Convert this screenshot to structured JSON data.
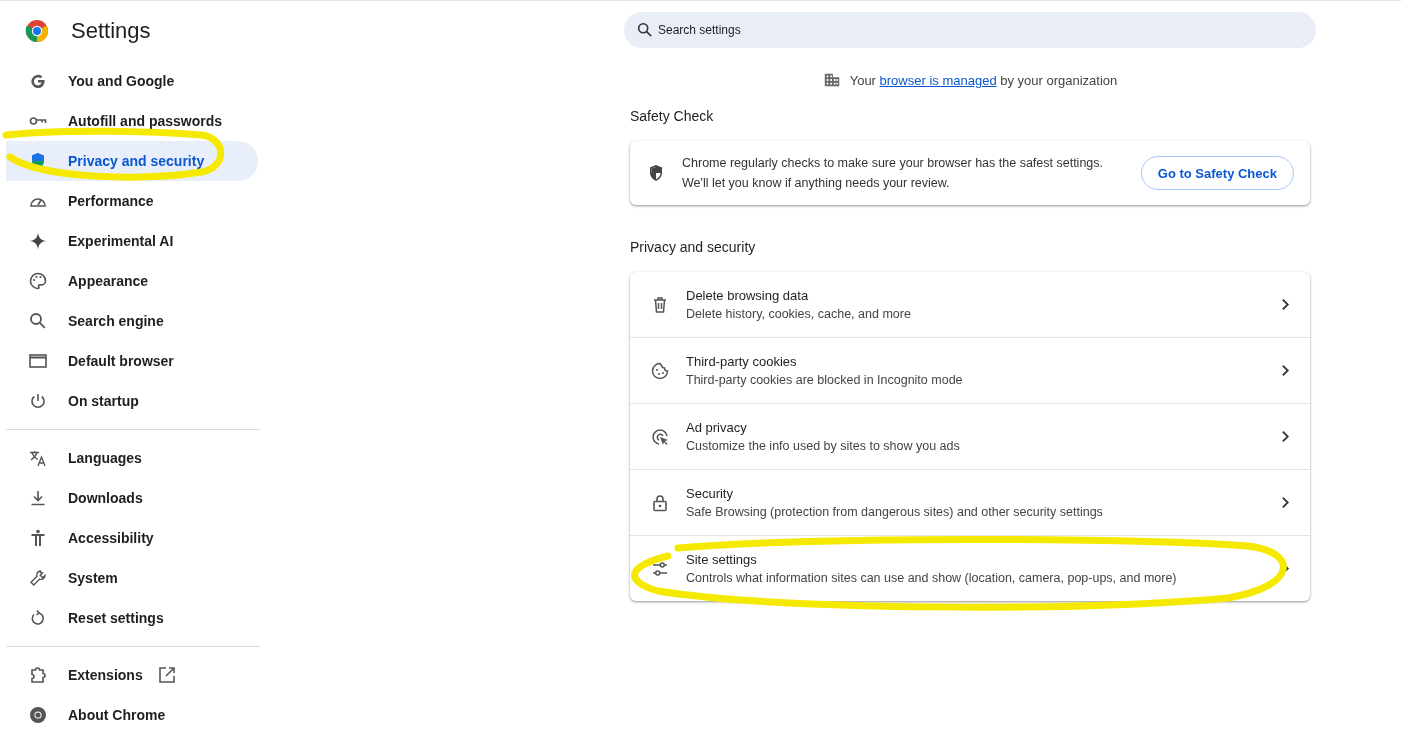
{
  "app": {
    "title": "Settings"
  },
  "sidebar": {
    "groups": [
      {
        "items": [
          {
            "label": "You and Google",
            "selected": false
          },
          {
            "label": "Autofill and passwords",
            "selected": false
          },
          {
            "label": "Privacy and security",
            "selected": true
          },
          {
            "label": "Performance",
            "selected": false
          },
          {
            "label": "Experimental AI",
            "selected": false
          },
          {
            "label": "Appearance",
            "selected": false
          },
          {
            "label": "Search engine",
            "selected": false
          },
          {
            "label": "Default browser",
            "selected": false
          },
          {
            "label": "On startup",
            "selected": false
          }
        ]
      },
      {
        "items": [
          {
            "label": "Languages",
            "selected": false
          },
          {
            "label": "Downloads",
            "selected": false
          },
          {
            "label": "Accessibility",
            "selected": false
          },
          {
            "label": "System",
            "selected": false
          },
          {
            "label": "Reset settings",
            "selected": false
          }
        ]
      },
      {
        "items": [
          {
            "label": "Extensions",
            "selected": false
          },
          {
            "label": "About Chrome",
            "selected": false
          }
        ]
      }
    ]
  },
  "search": {
    "placeholder": "Search settings"
  },
  "managed_notice": {
    "before": "Your",
    "link": "browser is managed",
    "after": "by your organization"
  },
  "safety_check": {
    "heading": "Safety Check",
    "lines": [
      "Chrome regularly checks to make sure your browser has the safest settings.",
      "We'll let you know if anything needs your review."
    ],
    "button": "Go to Safety Check"
  },
  "privacy": {
    "heading": "Privacy and security",
    "rows": [
      {
        "title": "Delete browsing data",
        "subtitle": "Delete history, cookies, cache, and more"
      },
      {
        "title": "Third-party cookies",
        "subtitle": "Third-party cookies are blocked in Incognito mode"
      },
      {
        "title": "Ad privacy",
        "subtitle": "Customize the info used by sites to show you ads"
      },
      {
        "title": "Security",
        "subtitle": "Safe Browsing (protection from dangerous sites) and other security settings"
      },
      {
        "title": "Site settings",
        "subtitle": "Controls what information sites can use and show (location, camera, pop-ups, and more)"
      }
    ]
  }
}
